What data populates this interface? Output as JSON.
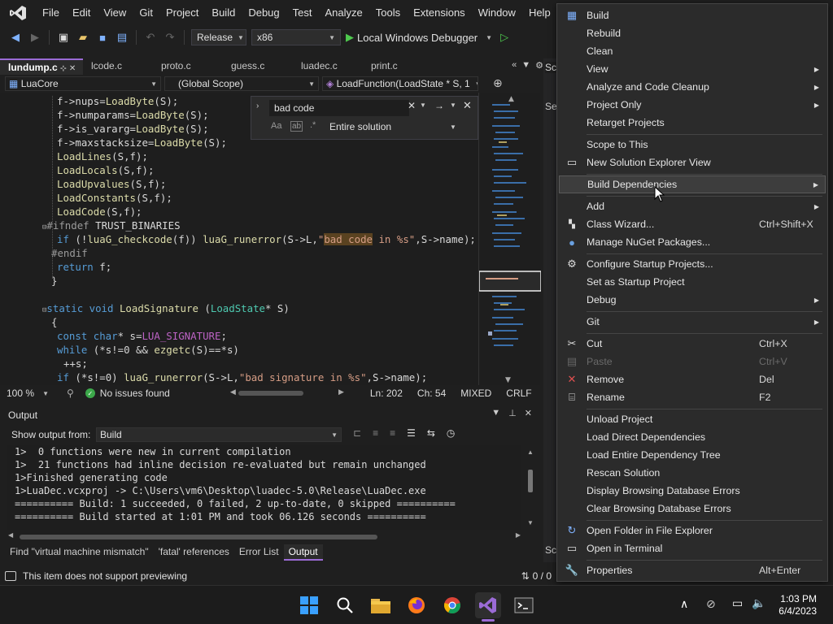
{
  "menubar": {
    "items": [
      "File",
      "Edit",
      "View",
      "Git",
      "Project",
      "Build",
      "Debug",
      "Test",
      "Analyze",
      "Tools",
      "Extensions",
      "Window",
      "Help"
    ]
  },
  "toolbar": {
    "configuration": "Release",
    "platform": "x86",
    "debugger": "Local Windows Debugger"
  },
  "tabs": [
    {
      "label": "lundump.c",
      "active": true
    },
    {
      "label": "lcode.c"
    },
    {
      "label": "proto.c"
    },
    {
      "label": "guess.c"
    },
    {
      "label": "luadec.c"
    },
    {
      "label": "print.c"
    }
  ],
  "navbar": {
    "project": "LuaCore",
    "scope": "(Global Scope)",
    "function": "LoadFunction(LoadState * S, 1"
  },
  "find": {
    "query": "bad code",
    "scope": "Entire solution",
    "option_case": "Aa",
    "option_word": "ab"
  },
  "editor_status": {
    "zoom": "100 %",
    "issues": "No issues found",
    "line": "Ln: 202",
    "col": "Ch: 54",
    "mode": "MIXED",
    "eol": "CRLF"
  },
  "output": {
    "title": "Output",
    "show_from_label": "Show output from:",
    "source": "Build",
    "lines": [
      "1>  0 functions were new in current compilation",
      "1>  21 functions had inline decision re-evaluated but remain unchanged",
      "1>Finished generating code",
      "1>LuaDec.vcxproj -> C:\\Users\\vm6\\Desktop\\luadec-5.0\\Release\\LuaDec.exe",
      "========== Build: 1 succeeded, 0 failed, 2 up-to-date, 0 skipped ==========",
      "========== Build started at 1:01 PM and took 06.126 seconds =========="
    ]
  },
  "bottom_tabs": [
    {
      "label": "Find \"virtual machine mismatch\""
    },
    {
      "label": "'fatal' references"
    },
    {
      "label": "Error List"
    },
    {
      "label": "Output",
      "active": true
    }
  ],
  "statusbar": {
    "message": "This item does not support previewing",
    "counter": "0 / 0"
  },
  "side_panel": {
    "label_top": "Sc",
    "label_mid": "Se",
    "label_bottom": "Sc"
  },
  "context_menu": {
    "items": [
      {
        "label": "Build",
        "icon": "build-icon"
      },
      {
        "label": "Rebuild"
      },
      {
        "label": "Clean"
      },
      {
        "label": "View",
        "submenu": true
      },
      {
        "label": "Analyze and Code Cleanup",
        "submenu": true
      },
      {
        "label": "Project Only",
        "submenu": true
      },
      {
        "label": "Retarget Projects"
      },
      {
        "label": "Scope to This"
      },
      {
        "label": "New Solution Explorer View",
        "icon": "new-view-icon"
      },
      {
        "label": "Build Dependencies",
        "submenu": true,
        "hover": true
      },
      {
        "label": "Add",
        "submenu": true
      },
      {
        "label": "Class Wizard...",
        "shortcut": "Ctrl+Shift+X",
        "icon": "class-wizard-icon"
      },
      {
        "label": "Manage NuGet Packages...",
        "icon": "nuget-icon"
      },
      {
        "label": "Configure Startup Projects...",
        "icon": "gear-icon"
      },
      {
        "label": "Set as Startup Project"
      },
      {
        "label": "Debug",
        "submenu": true
      },
      {
        "label": "Git",
        "submenu": true
      },
      {
        "label": "Cut",
        "shortcut": "Ctrl+X",
        "icon": "scissors-icon"
      },
      {
        "label": "Paste",
        "shortcut": "Ctrl+V",
        "disabled": true,
        "icon": "paste-icon"
      },
      {
        "label": "Remove",
        "shortcut": "Del",
        "icon": "remove-icon"
      },
      {
        "label": "Rename",
        "shortcut": "F2",
        "icon": "rename-icon"
      },
      {
        "label": "Unload Project"
      },
      {
        "label": "Load Direct Dependencies"
      },
      {
        "label": "Load Entire Dependency Tree"
      },
      {
        "label": "Rescan Solution"
      },
      {
        "label": "Display Browsing Database Errors"
      },
      {
        "label": "Clear Browsing Database Errors"
      },
      {
        "label": "Open Folder in File Explorer",
        "icon": "refresh-folder-icon"
      },
      {
        "label": "Open in Terminal",
        "icon": "terminal-icon"
      },
      {
        "label": "Properties",
        "shortcut": "Alt+Enter",
        "icon": "wrench-icon"
      }
    ]
  },
  "taskbar": {
    "time": "1:03 PM",
    "date": "6/4/2023"
  },
  "colors": {
    "accent": "#9b6bd6",
    "keyword": "#569cd6",
    "function": "#dcdcaa",
    "macro": "#bd63c5",
    "string": "#d69d85"
  }
}
